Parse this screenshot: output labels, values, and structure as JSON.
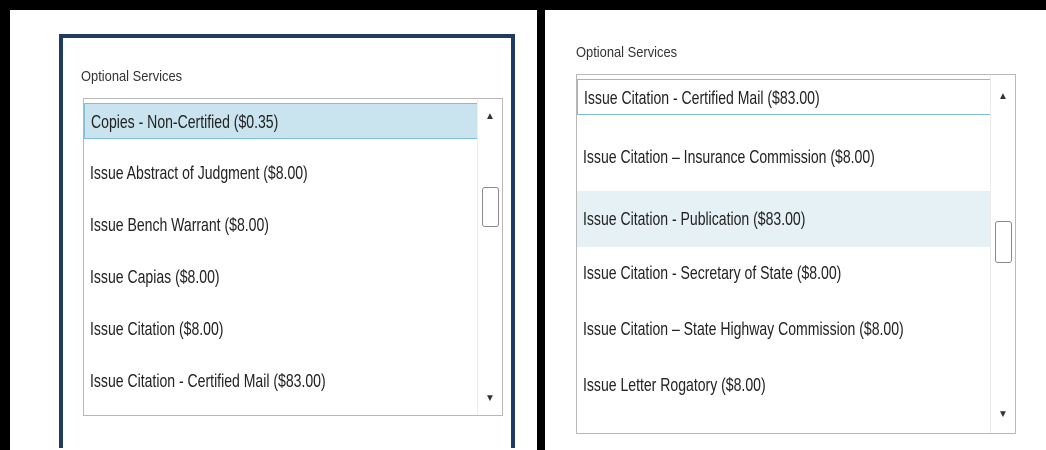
{
  "left_panel": {
    "title": "Optional Services",
    "options": [
      {
        "label": "Copies - Non-Certified ($0.35)",
        "state": "selected"
      },
      {
        "label": "Issue Abstract of Judgment ($8.00)",
        "state": "normal"
      },
      {
        "label": "Issue Bench Warrant ($8.00)",
        "state": "normal"
      },
      {
        "label": "Issue Capias ($8.00)",
        "state": "normal"
      },
      {
        "label": "Issue Citation ($8.00)",
        "state": "normal"
      },
      {
        "label": "Issue Citation - Certified Mail ($83.00)",
        "state": "normal"
      }
    ],
    "scroll_up_icon": "scroll-up-arrow-icon",
    "scroll_down_icon": "scroll-down-arrow-icon"
  },
  "right_panel": {
    "title": "Optional Services",
    "options": [
      {
        "label": "Issue Citation - Certified Mail ($83.00)",
        "state": "focused"
      },
      {
        "label": "Issue Citation – Insurance Commission ($8.00)",
        "state": "normal"
      },
      {
        "label": "Issue Citation - Publication ($83.00)",
        "state": "hover"
      },
      {
        "label": "Issue Citation - Secretary of State ($8.00)",
        "state": "normal"
      },
      {
        "label": "Issue Citation – State Highway Commission ($8.00)",
        "state": "normal"
      },
      {
        "label": "Issue Letter Rogatory ($8.00)",
        "state": "normal"
      }
    ],
    "scroll_up_icon": "scroll-up-arrow-icon",
    "scroll_down_icon": "scroll-down-arrow-icon"
  },
  "colors": {
    "panel_border": "#1f3a64",
    "selected_bg": "#c9e4ee",
    "hover_bg": "#e6f1f5",
    "focus_border": "#7fc0d8"
  }
}
